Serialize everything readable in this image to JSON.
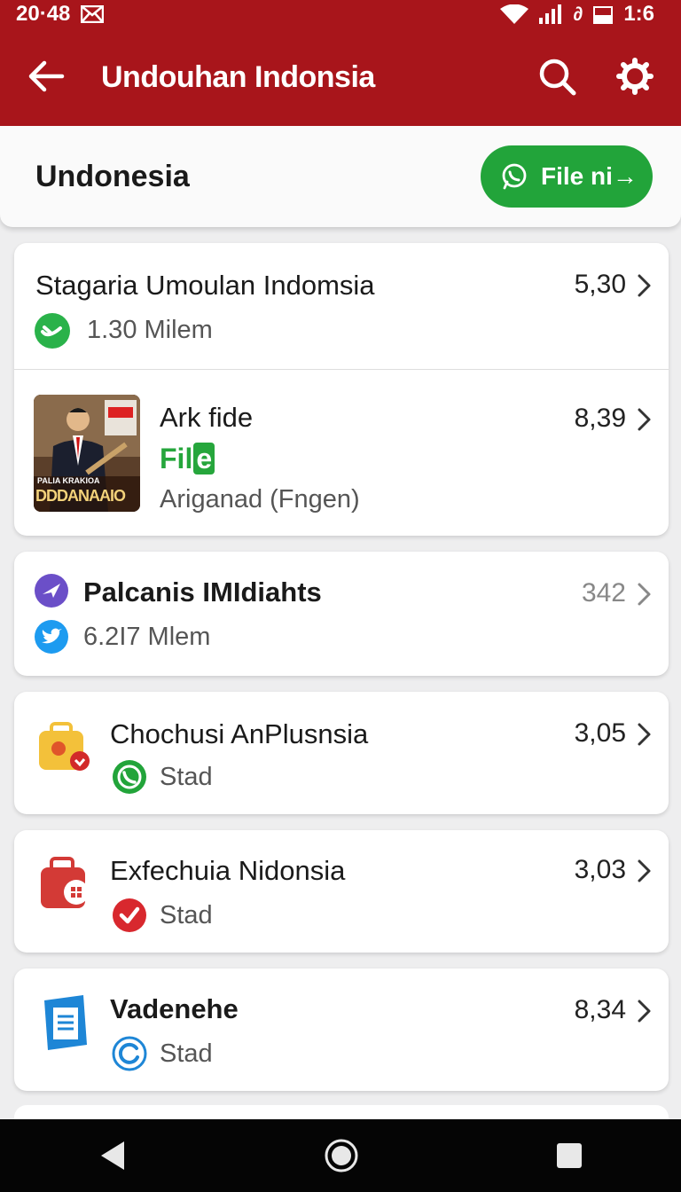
{
  "status": {
    "time_left": "20·48",
    "time_right": "1:6",
    "wifi_icon": "wifi-icon",
    "signal_icon": "signal-icon",
    "battery_icon": "battery-icon",
    "mail_icon": "mail-icon"
  },
  "appbar": {
    "title": "Undouhan Indonsia",
    "back_icon": "arrow-left-icon",
    "search_icon": "search-icon",
    "settings_icon": "gear-icon"
  },
  "header": {
    "title": "Undonesia",
    "button_label": "File ni→",
    "button_icon": "whatsapp-icon",
    "button_color": "#22a43a"
  },
  "colors": {
    "brand": "#a8151b",
    "green": "#26a63c"
  },
  "items": [
    {
      "title": "Stagaria Umoulan Indomsia",
      "subtitle": "1.30 Milem",
      "value": "5,30",
      "icon": "green-badge-icon"
    },
    {
      "title": "Ark fide",
      "tag": "Fil",
      "tag_box": "e",
      "subtitle": "Ariganad (Fngen)",
      "value": "8,39",
      "thumb_text": "DDDANAAIO",
      "thumb_caption": "PALIA KRAKIOA"
    },
    {
      "title": "Palcanis IMIdiahts",
      "subtitle": "6.2I7 Mlem",
      "value": "342",
      "icon": "plane-icon",
      "sub_icon": "twitter-icon"
    },
    {
      "title": "Chochusi AnPlusnsia",
      "subtitle": "Stad",
      "value": "3,05",
      "icon": "briefcase-icon",
      "sub_icon": "phone-icon"
    },
    {
      "title": "Exfechuia Nidonsia",
      "subtitle": "Stad",
      "value": "3,03",
      "icon": "red-bag-icon",
      "sub_icon": "check-icon"
    },
    {
      "title": "Vadenehe",
      "subtitle": "Stad",
      "value": "8,34",
      "icon": "document-icon",
      "sub_icon": "refresh-icon"
    }
  ],
  "nav": {
    "back_icon": "nav-back-icon",
    "home_icon": "nav-home-icon",
    "recents_icon": "nav-recents-icon"
  }
}
